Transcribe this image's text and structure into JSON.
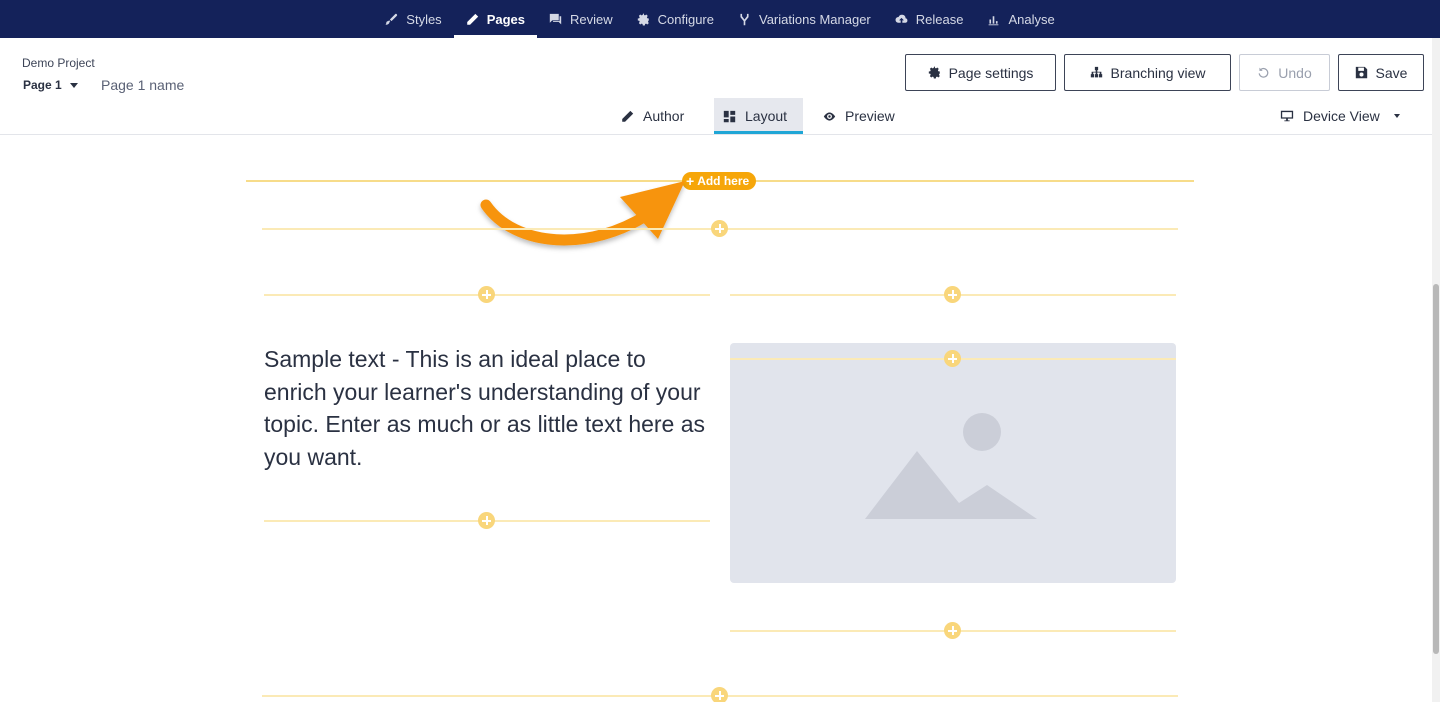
{
  "topnav": {
    "items": [
      {
        "label": "Styles",
        "icon": "brush-icon"
      },
      {
        "label": "Pages",
        "icon": "pencil-icon",
        "active": true
      },
      {
        "label": "Review",
        "icon": "chat-icon"
      },
      {
        "label": "Configure",
        "icon": "gear-icon"
      },
      {
        "label": "Variations Manager",
        "icon": "fork-icon"
      },
      {
        "label": "Release",
        "icon": "cloud-upload-icon"
      },
      {
        "label": "Analyse",
        "icon": "bar-chart-icon"
      }
    ]
  },
  "header": {
    "project_name": "Demo Project",
    "page_select": "Page 1",
    "page_name": "Page 1 name",
    "buttons": {
      "page_settings": "Page settings",
      "branching_view": "Branching view",
      "undo": "Undo",
      "save": "Save"
    },
    "tabs": {
      "author": "Author",
      "layout": "Layout",
      "preview": "Preview"
    },
    "active_tab": "Layout",
    "device_view": "Device View"
  },
  "canvas": {
    "add_here": "Add here",
    "sample_text": "Sample text - This is an ideal place to enrich your learner's understanding of your topic. Enter as much or as little text here as you want."
  },
  "colors": {
    "nav_bg": "#14225a",
    "accent_orange": "#f6a609",
    "insert_line": "#fbeab6",
    "tab_underline": "#1fa6d6",
    "image_placeholder": "#e1e4ec"
  }
}
